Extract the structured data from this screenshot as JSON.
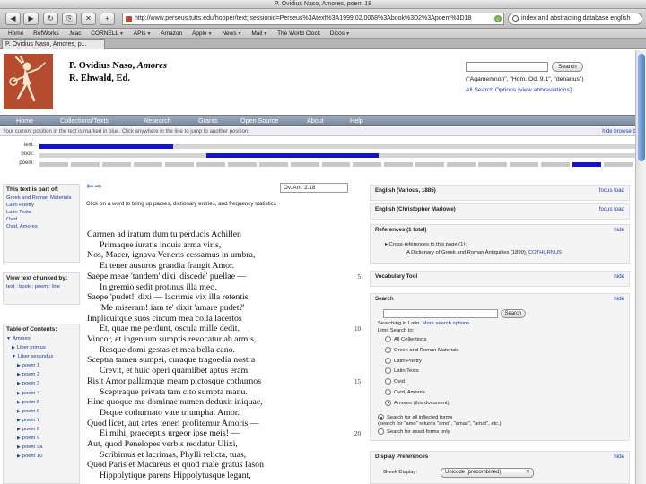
{
  "window": {
    "title": "P. Ovidius Naso, Amores, poem 18"
  },
  "browser": {
    "url": "http://www.perseus.tufts.edu/hopper/text;jsessionid=Perseus%3Atext%3A1999.02.0068%3Abook%3D2%3Apoem%3D18",
    "search_value": "index and abstracting database english"
  },
  "bookmarks": [
    "Home",
    "RefWorks",
    ".Mac",
    "CORNELL",
    "APIs",
    "Amazon",
    "Apple",
    "News",
    "Mail",
    "The World Clock",
    "Dicos"
  ],
  "tab": {
    "label": "P. Ovidius Naso, Amores, p..."
  },
  "header": {
    "author": "P. Ovidius Naso,",
    "work": "Amores",
    "editor": "R. Ehwald, Ed.",
    "search_button": "Search",
    "search_hint": "(\"Agamemnon\", \"Hom. Od. 9.1\", \"denarius\")",
    "search_options": "All Search Options",
    "view_abbreviations": "[view abbreviations]"
  },
  "site_nav": [
    "Home",
    "Collections/Texts",
    "Research",
    "Grants",
    "Open Source",
    "About",
    "Help"
  ],
  "info_bar": {
    "text": "Your current position in the text is marked in blue. Click anywhere in the line to jump to another position:",
    "hide_label": "hide browse bar"
  },
  "position_bars": {
    "labels": [
      "text:",
      "book:",
      "poem:"
    ],
    "text_fill": [
      0.0,
      0.225
    ],
    "book_fill": [
      0.28,
      0.57
    ],
    "poem_current_index": 17,
    "poem_count": 19
  },
  "left_panels": {
    "part_of_heading": "This text is part of:",
    "part_of_items": [
      "Greek and Roman Materials",
      "Latin Poetry",
      "Latin Texts",
      "Ovid",
      "Ovid, Amores"
    ],
    "view_chunked_heading": "View text chunked by:",
    "view_chunked_links": "text : book : poem : line",
    "toc_heading": "Table of Contents:",
    "toc_items": [
      "Amores",
      "Liber primus",
      "Liber secundus",
      "poem 1",
      "poem 2",
      "poem 3",
      "poem 4",
      "poem 5",
      "poem 6",
      "poem 7",
      "poem 8",
      "poem 9",
      "poem 9a",
      "poem 10"
    ]
  },
  "main": {
    "citation": "Ov. Am. 2.18",
    "click_hint": "Click on a word to bring up parses, dictionary entries, and frequency statistics",
    "lines": [
      "Carmen ad iratum dum tu perducis Achillen",
      "Primaque iuratis induis arma viris,",
      "Nos, Macer, ignava Veneris cessamus in umbra,",
      "Et tener ausuros grandia frangit Amor.",
      "Saepe meae 'tandem' dixi 'discede' puellae —",
      "In gremio sedit protinus illa meo.",
      "Saepe 'pudet!' dixi — lacrimis vix illa retentis",
      "'Me miseram! iam te' dixit 'amare pudet?'",
      "Implicuitque suos circum mea colla lacertos",
      "Et, quae me perdunt, oscula mille dedit.",
      "Vincor, et ingenium sumptis revocatur ab armis,",
      "Resque domi gestas et mea bella cano.",
      "Sceptra tamen sumpsi, curaque tragoedia nostra",
      "Crevit, et huic operi quamlibet aptus eram.",
      "Risit Amor pallamque meam pictosque cothurnos",
      "Sceptraque privata tam cito sumpta manu.",
      "Hinc quoque me dominae numen deduxit iniquae,",
      "Deque cothurnato vate triumphat Amor.",
      "Quod licet, aut artes teneri profitemur Amoris —",
      "Ei mihi, praeceptis urgeor ipse meis! —",
      "Aut, quod Penelopes verbis reddatur Ulixi,",
      "Scribimus et lacrimas, Phylli relicta, tuas,",
      "Quod Paris et Macareus et quod male gratus Iason",
      "Hippolytique parens Hippolytusque legant,"
    ],
    "line_numbers": [
      "5",
      "10",
      "15",
      "20"
    ]
  },
  "right_panels": {
    "english_various": {
      "title": "English (Various, 1885)",
      "links": "focus load"
    },
    "english_marlowe": {
      "title": "English (Christopher Marlowe)",
      "links": "focus load"
    },
    "references": {
      "title": "References (1 total)",
      "hide": "hide",
      "item": "Cross-references to this page (1):",
      "subitem_prefix": "A Dictionary of Greek and Roman Antiquities (1890), ",
      "subitem_link": "COTHURNUS"
    },
    "vocab_tool": {
      "title": "Vocabulary Tool",
      "hide": "hide"
    },
    "search": {
      "title": "Search",
      "hide": "hide",
      "button": "Search",
      "searching_in": "Searching in Latin.",
      "more_options": "More search options",
      "limit": "Limit Search to:",
      "options": [
        "All Collections",
        "Greek and Roman Materials",
        "Latin Poetry",
        "Latin Texts",
        "Ovid",
        "Ovid, Amores",
        "Amores (this document)"
      ],
      "selected_index": 6,
      "inflected": "Search for all inflected forms",
      "inflected_example": "(search for \"amo\" returns \"amo\", \"amas\", \"amat\", etc.)",
      "exact": "Search for exact forms only"
    },
    "display_prefs": {
      "title": "Display Preferences",
      "hide": "hide",
      "greek_label": "Greek Display:",
      "greek_value": "Unicode (precombined)"
    }
  }
}
